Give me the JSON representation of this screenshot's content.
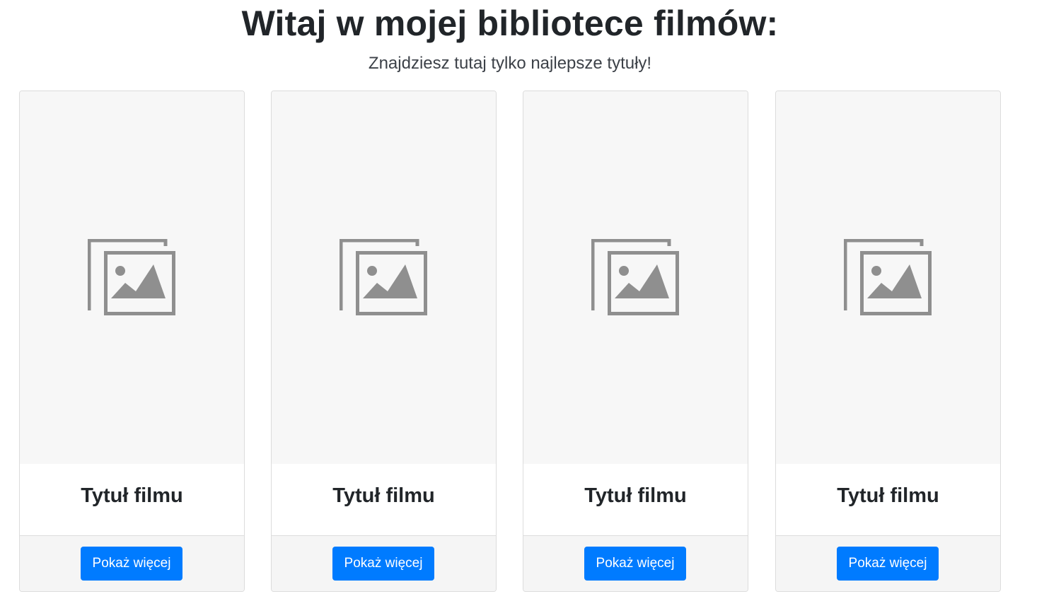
{
  "header": {
    "title": "Witaj w mojej bibliotece filmów:",
    "subtitle": "Znajdziesz tutaj tylko najlepsze tytuły!"
  },
  "icons": {
    "placeholder": "image-placeholder-icon"
  },
  "colors": {
    "button": "#007bff",
    "placeholder_bg": "#f7f7f7",
    "placeholder_icon": "#8f8f8f"
  },
  "cards": [
    {
      "title": "Tytuł filmu",
      "button_label": "Pokaż więcej"
    },
    {
      "title": "Tytuł filmu",
      "button_label": "Pokaż więcej"
    },
    {
      "title": "Tytuł filmu",
      "button_label": "Pokaż więcej"
    },
    {
      "title": "Tytuł filmu",
      "button_label": "Pokaż więcej"
    }
  ]
}
